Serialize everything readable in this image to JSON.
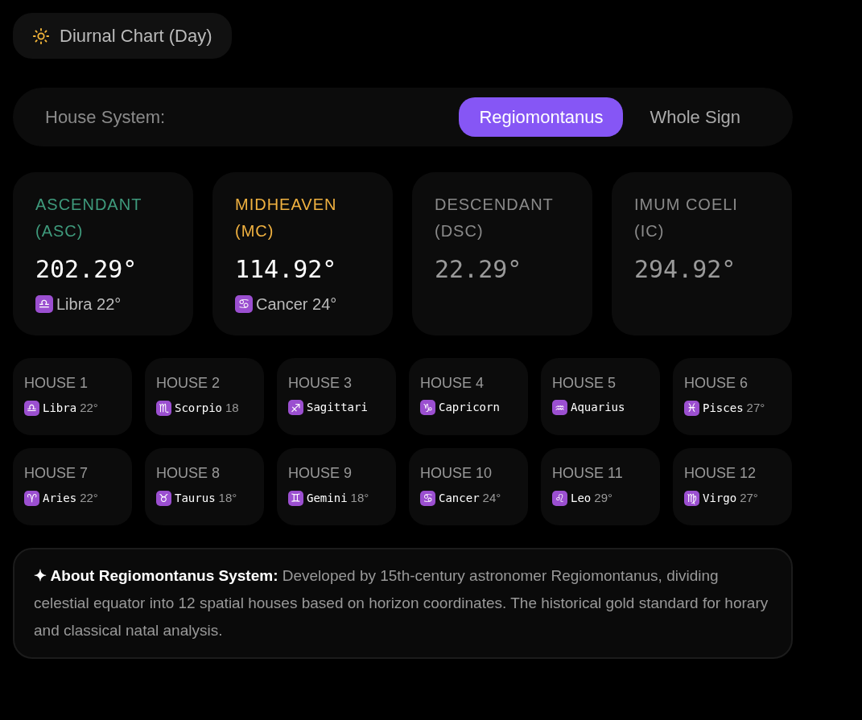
{
  "chart_badge": {
    "label": "Diurnal Chart (Day)"
  },
  "house_system": {
    "label": "House System:",
    "options": [
      {
        "label": "Regiomontanus",
        "selected": true
      },
      {
        "label": "Whole Sign",
        "selected": false
      }
    ]
  },
  "angles": [
    {
      "label": "ASCENDANT (ASC)",
      "color": "#3f9a7c",
      "value": "202.29°",
      "dimmed": false,
      "sign_symbol": "♎",
      "sign": "Libra 22°"
    },
    {
      "label": "MIDHEAVEN (MC)",
      "color": "#f0b140",
      "value": "114.92°",
      "dimmed": false,
      "sign_symbol": "♋",
      "sign": "Cancer 24°"
    },
    {
      "label": "DESCENDANT (DSC)",
      "color": "#8a8a8a",
      "value": "22.29°",
      "dimmed": true
    },
    {
      "label": "IMUM COELI (IC)",
      "color": "#8a8a8a",
      "value": "294.92°",
      "dimmed": true
    }
  ],
  "houses": [
    {
      "label": "HOUSE 1",
      "symbol": "♎",
      "sign": "Libra",
      "degree": "22°"
    },
    {
      "label": "HOUSE 2",
      "symbol": "♏",
      "sign": "Scorpio",
      "degree": "18"
    },
    {
      "label": "HOUSE 3",
      "symbol": "♐",
      "sign": "Sagittari"
    },
    {
      "label": "HOUSE 4",
      "symbol": "♑",
      "sign": "Capricorn"
    },
    {
      "label": "HOUSE 5",
      "symbol": "♒",
      "sign": "Aquarius"
    },
    {
      "label": "HOUSE 6",
      "symbol": "♓",
      "sign": "Pisces",
      "degree": "27°"
    },
    {
      "label": "HOUSE 7",
      "symbol": "♈",
      "sign": "Aries",
      "degree": "22°"
    },
    {
      "label": "HOUSE 8",
      "symbol": "♉",
      "sign": "Taurus",
      "degree": "18°"
    },
    {
      "label": "HOUSE 9",
      "symbol": "♊",
      "sign": "Gemini",
      "degree": "18°"
    },
    {
      "label": "HOUSE 10",
      "symbol": "♋",
      "sign": "Cancer",
      "degree": "24°"
    },
    {
      "label": "HOUSE 11",
      "symbol": "♌",
      "sign": "Leo",
      "degree": "29°"
    },
    {
      "label": "HOUSE 12",
      "symbol": "♍",
      "sign": "Virgo",
      "degree": "27°"
    }
  ],
  "about": {
    "text": "**✦ About Regiomontanus System:** Developed by 15th-century astronomer Regiomontanus, dividing celestial equator into 12 spatial houses based on horizon coordinates. The historical gold standard for horary and classical natal analysis."
  }
}
